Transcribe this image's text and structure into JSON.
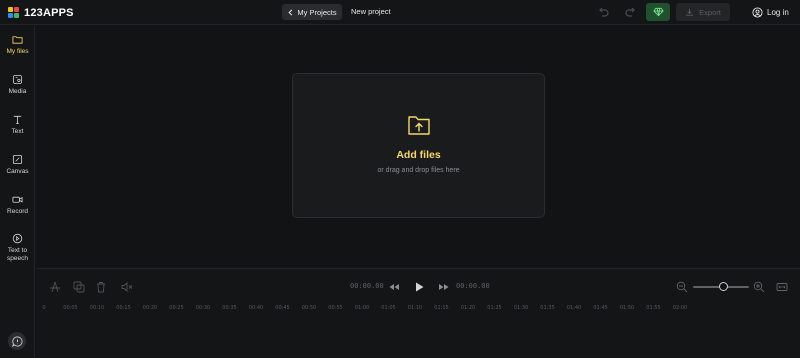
{
  "header": {
    "logo_text": "123APPS",
    "logo_colors": [
      "#f2c21b",
      "#e64a3c",
      "#2f8cf0",
      "#45b36b"
    ],
    "my_projects": "My Projects",
    "new_project": "New project",
    "export": "Export",
    "login": "Log in",
    "premium_color": "#20512f"
  },
  "sidebar": {
    "items": [
      {
        "label": "My files",
        "icon": "folder-icon",
        "active": true
      },
      {
        "label": "Media",
        "icon": "media-icon"
      },
      {
        "label": "Text",
        "icon": "text-icon"
      },
      {
        "label": "Canvas",
        "icon": "canvas-icon"
      },
      {
        "label": "Record",
        "icon": "camera-icon"
      },
      {
        "label": "Text to speech",
        "icon": "speech-icon"
      }
    ],
    "help_icon": "chat-help-icon"
  },
  "dropzone": {
    "title": "Add files",
    "subtitle": "or drag and drop files here",
    "accent": "#f5d86a"
  },
  "timeline": {
    "current_time": "00:00.00",
    "total_time": "00:00.00",
    "zoom_level": 0.55,
    "ticks": [
      "0",
      "00:05",
      "00:10",
      "00:15",
      "00:20",
      "00:25",
      "00:30",
      "00:35",
      "00:40",
      "00:45",
      "00:50",
      "00:55",
      "01:00",
      "01:05",
      "01:10",
      "01:15",
      "01:20",
      "01:25",
      "01:30",
      "01:35",
      "01:40",
      "01:45",
      "01:50",
      "01:55",
      "02:00"
    ]
  }
}
